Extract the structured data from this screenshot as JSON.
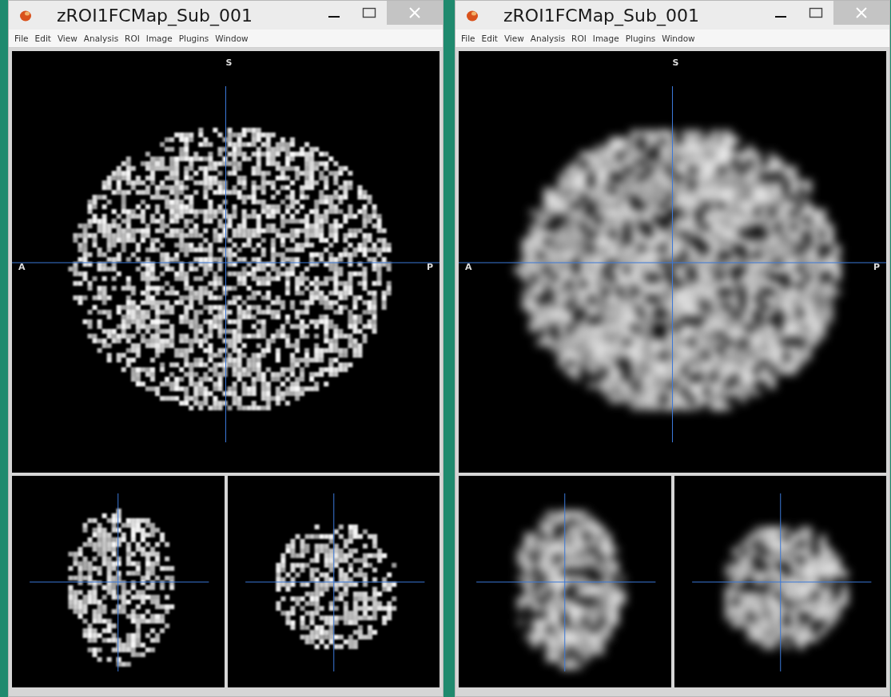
{
  "windows": [
    {
      "title": "zROI1FCMap_Sub_001",
      "kind": "raw",
      "menu": [
        "File",
        "Edit",
        "View",
        "Analysis",
        "ROI",
        "Image",
        "Plugins",
        "Window"
      ],
      "main_view": {
        "top": "S",
        "left": "A",
        "right": "P"
      }
    },
    {
      "title": "zROI1FCMap_Sub_001",
      "kind": "smoothed",
      "menu": [
        "File",
        "Edit",
        "View",
        "Analysis",
        "ROI",
        "Image",
        "Plugins",
        "Window"
      ],
      "main_view": {
        "top": "S",
        "left": "A",
        "right": "P"
      }
    }
  ]
}
